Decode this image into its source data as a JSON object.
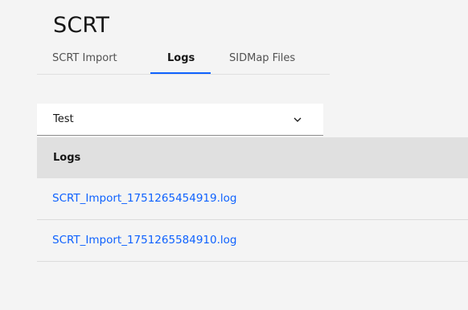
{
  "page": {
    "title": "SCRT"
  },
  "tabs": [
    {
      "label": "SCRT Import",
      "active": false
    },
    {
      "label": "Logs",
      "active": true
    },
    {
      "label": "SIDMap Files",
      "active": false
    }
  ],
  "dropdown": {
    "selected": "Test",
    "icon": "chevron-down-icon"
  },
  "logs_table": {
    "header": "Logs",
    "rows": [
      {
        "filename": "SCRT_Import_1751265454919.log"
      },
      {
        "filename": "SCRT_Import_1751265584910.log"
      }
    ]
  },
  "colors": {
    "background": "#f4f4f4",
    "link": "#0f62fe",
    "active_tab_underline": "#0f62fe",
    "header_bg": "#e0e0e0"
  }
}
